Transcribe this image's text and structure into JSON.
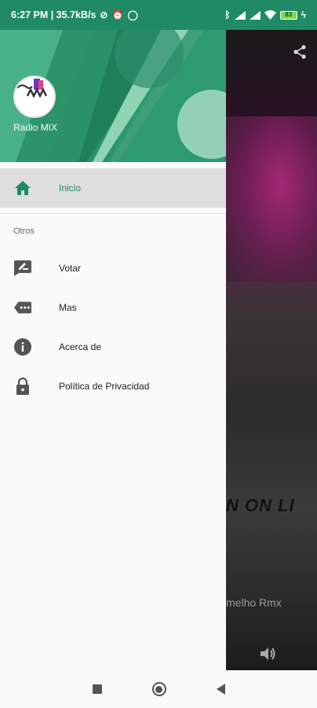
{
  "status_bar": {
    "time_and_speed": "6:27 PM | 35.7kB/s",
    "battery": "83",
    "icons": [
      "sync-off-icon",
      "alarm-icon",
      "whatsapp-icon",
      "bluetooth-icon",
      "signal-icon",
      "signal-icon",
      "wifi-icon",
      "battery-icon",
      "charging-icon"
    ]
  },
  "background_app": {
    "share_icon": "share-icon",
    "banner_text": "N ON LI",
    "track_text": "melho Rmx",
    "volume_icon": "volume-icon"
  },
  "drawer": {
    "header": {
      "app_name": "Radio MIX",
      "logo": "radio-mix-logo",
      "accent_color": "#2e9a70"
    },
    "primary_items": [
      {
        "label": "Inicio",
        "icon": "home-icon",
        "active": true
      }
    ],
    "section_title": "Otros",
    "secondary_items": [
      {
        "label": "Votar",
        "icon": "rate-review-icon"
      },
      {
        "label": "Mas",
        "icon": "more-label-icon"
      },
      {
        "label": "Acerca de",
        "icon": "info-icon"
      },
      {
        "label": "Política de Privacidad",
        "icon": "lock-icon"
      }
    ]
  },
  "nav_bar": {
    "buttons": [
      "recents-button",
      "home-button",
      "back-button"
    ]
  },
  "colors": {
    "primary": "#1f8a63",
    "active_text": "#1d8a62",
    "active_bg": "#dedede",
    "icon_gray": "#555555"
  }
}
